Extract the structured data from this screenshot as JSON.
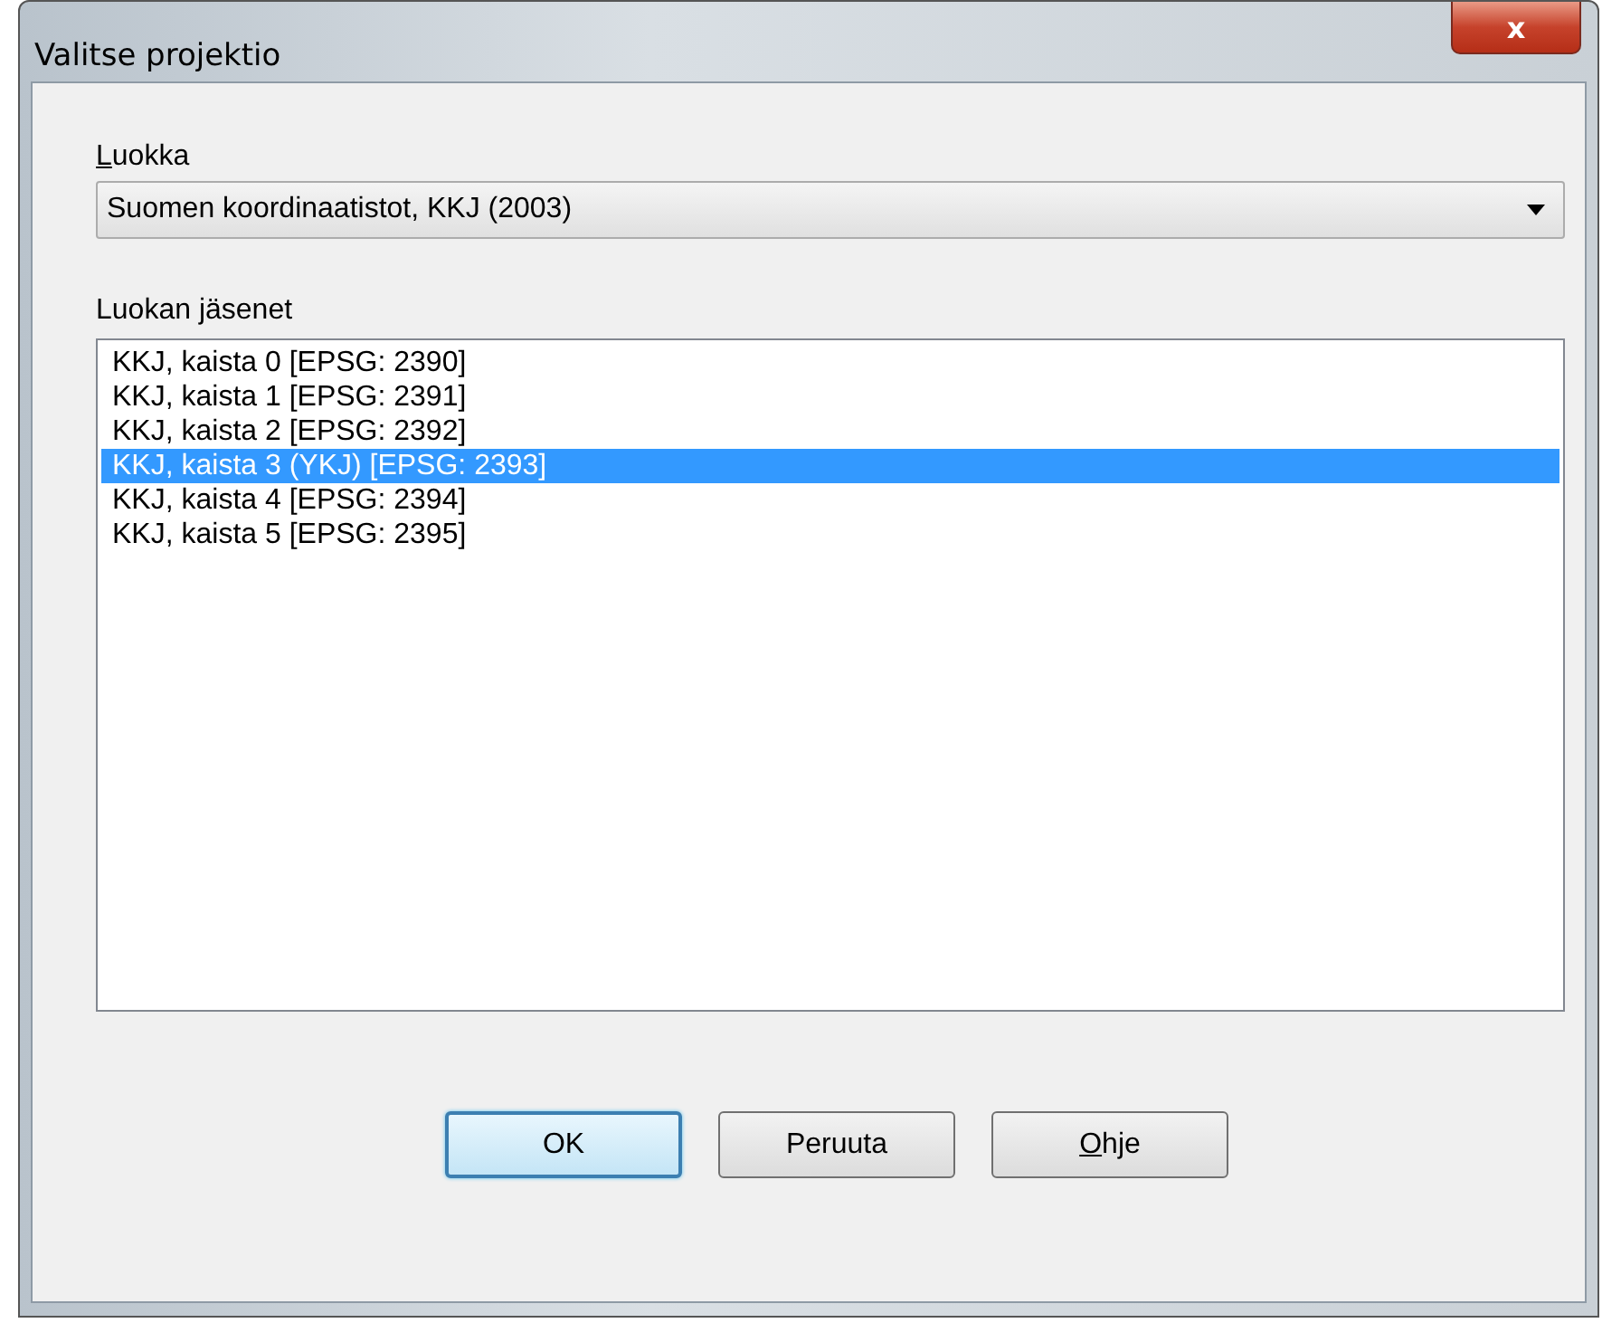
{
  "window": {
    "title": "Valitse projektio",
    "close_label": "x"
  },
  "category": {
    "label": "Luokka",
    "underline_first": true,
    "value": "Suomen koordinaatistot, KKJ (2003)"
  },
  "members": {
    "label": "Luokan jäsenet",
    "items": [
      {
        "text": "KKJ, kaista 0 [EPSG: 2390]",
        "selected": false
      },
      {
        "text": "KKJ, kaista 1 [EPSG: 2391]",
        "selected": false
      },
      {
        "text": "KKJ, kaista 2 [EPSG: 2392]",
        "selected": false
      },
      {
        "text": "KKJ, kaista 3 (YKJ) [EPSG: 2393]",
        "selected": true
      },
      {
        "text": "KKJ, kaista 4 [EPSG: 2394]",
        "selected": false
      },
      {
        "text": "KKJ, kaista 5 [EPSG: 2395]",
        "selected": false
      }
    ]
  },
  "buttons": [
    {
      "label": "OK",
      "default": true,
      "underline_first": false
    },
    {
      "label": "Peruuta",
      "default": false,
      "underline_first": false
    },
    {
      "label": "Ohje",
      "default": false,
      "underline_first": true
    }
  ]
}
